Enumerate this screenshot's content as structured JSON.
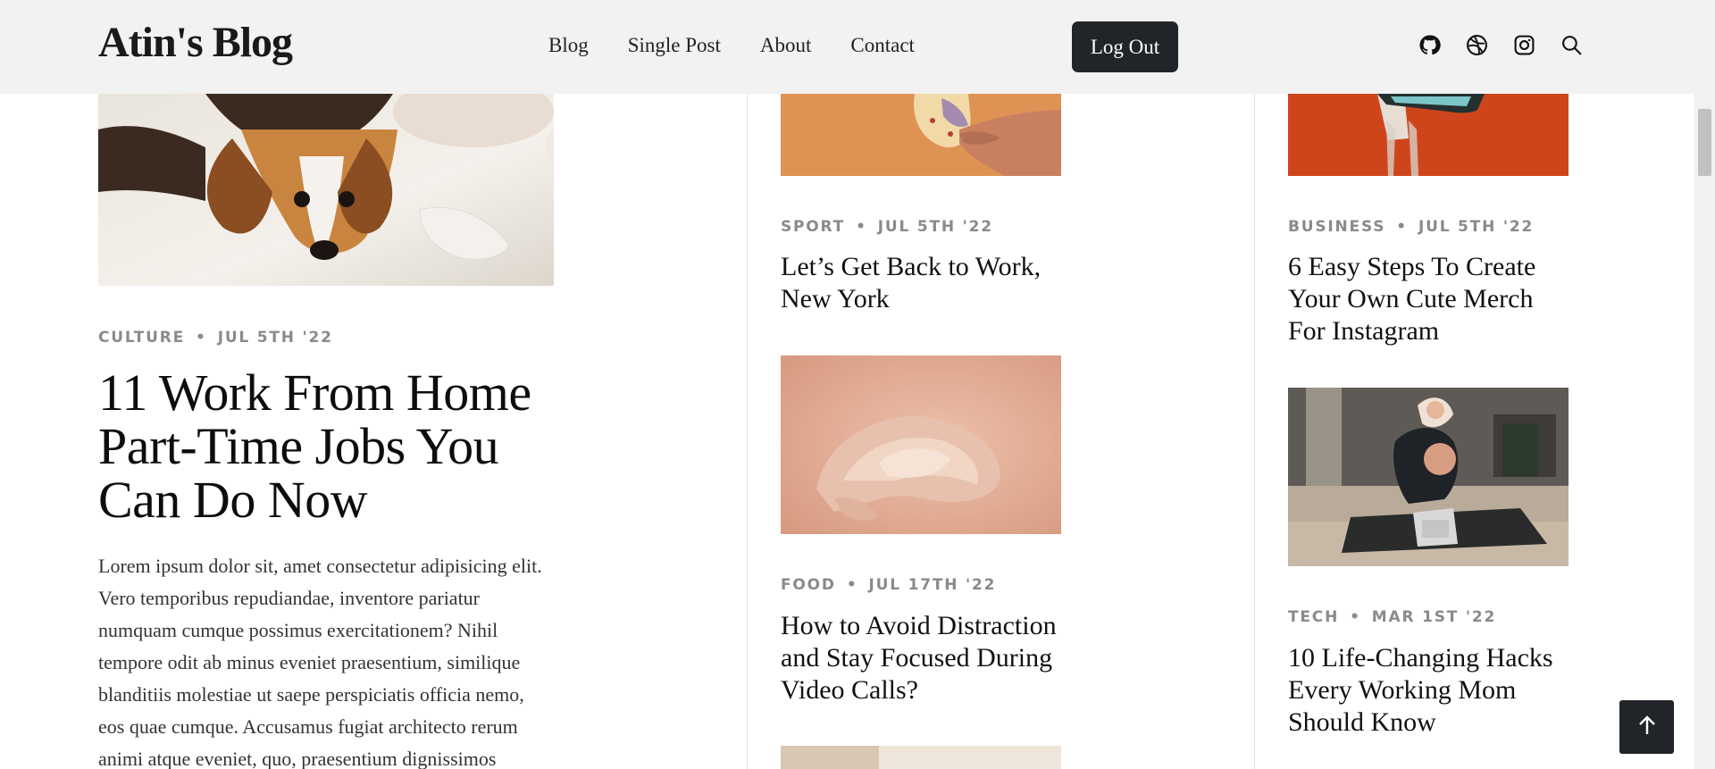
{
  "header": {
    "brand": "Atin's Blog",
    "nav": [
      "Blog",
      "Single Post",
      "About",
      "Contact"
    ],
    "logout_label": "Log Out",
    "icons": [
      "github-icon",
      "dribbble-icon",
      "instagram-icon",
      "search-icon"
    ]
  },
  "feature": {
    "category": "CULTURE",
    "date": "JUL 5TH '22",
    "title": "11 Work From Home Part-Time Jobs You Can Do Now",
    "excerpt": "Lorem ipsum dolor sit, amet consectetur adipisicing elit. Vero temporibus repudiandae, inventore pariatur numquam cumque possimus exercitationem? Nihil tempore odit ab minus eveniet praesentium, similique blanditiis molestiae ut saepe perspiciatis officia nemo, eos quae cumque. Accusamus fugiat architecto rerum animi atque eveniet, quo, praesentium dignissimos"
  },
  "posts": [
    {
      "category": "SPORT",
      "date": "JUL 5TH '22",
      "title": "Let’s Get Back to Work, New York"
    },
    {
      "category": "FOOD",
      "date": "JUL 17TH '22",
      "title": "How to Avoid Distraction and Stay Focused During Video Calls?"
    },
    {
      "category": "BUSINESS",
      "date": "JUL 5TH '22",
      "title": "6 Easy Steps To Create Your Own Cute Merch For Instagram"
    },
    {
      "category": "TECH",
      "date": "MAR 1ST '22",
      "title": "10 Life-Changing Hacks Every Working Mom Should Know"
    }
  ],
  "colors": {
    "header_bg": "#f2f2f2",
    "button_dark": "#212529",
    "meta_gray": "#8a8a8a"
  },
  "back_to_top_icon": "arrow-up-icon"
}
